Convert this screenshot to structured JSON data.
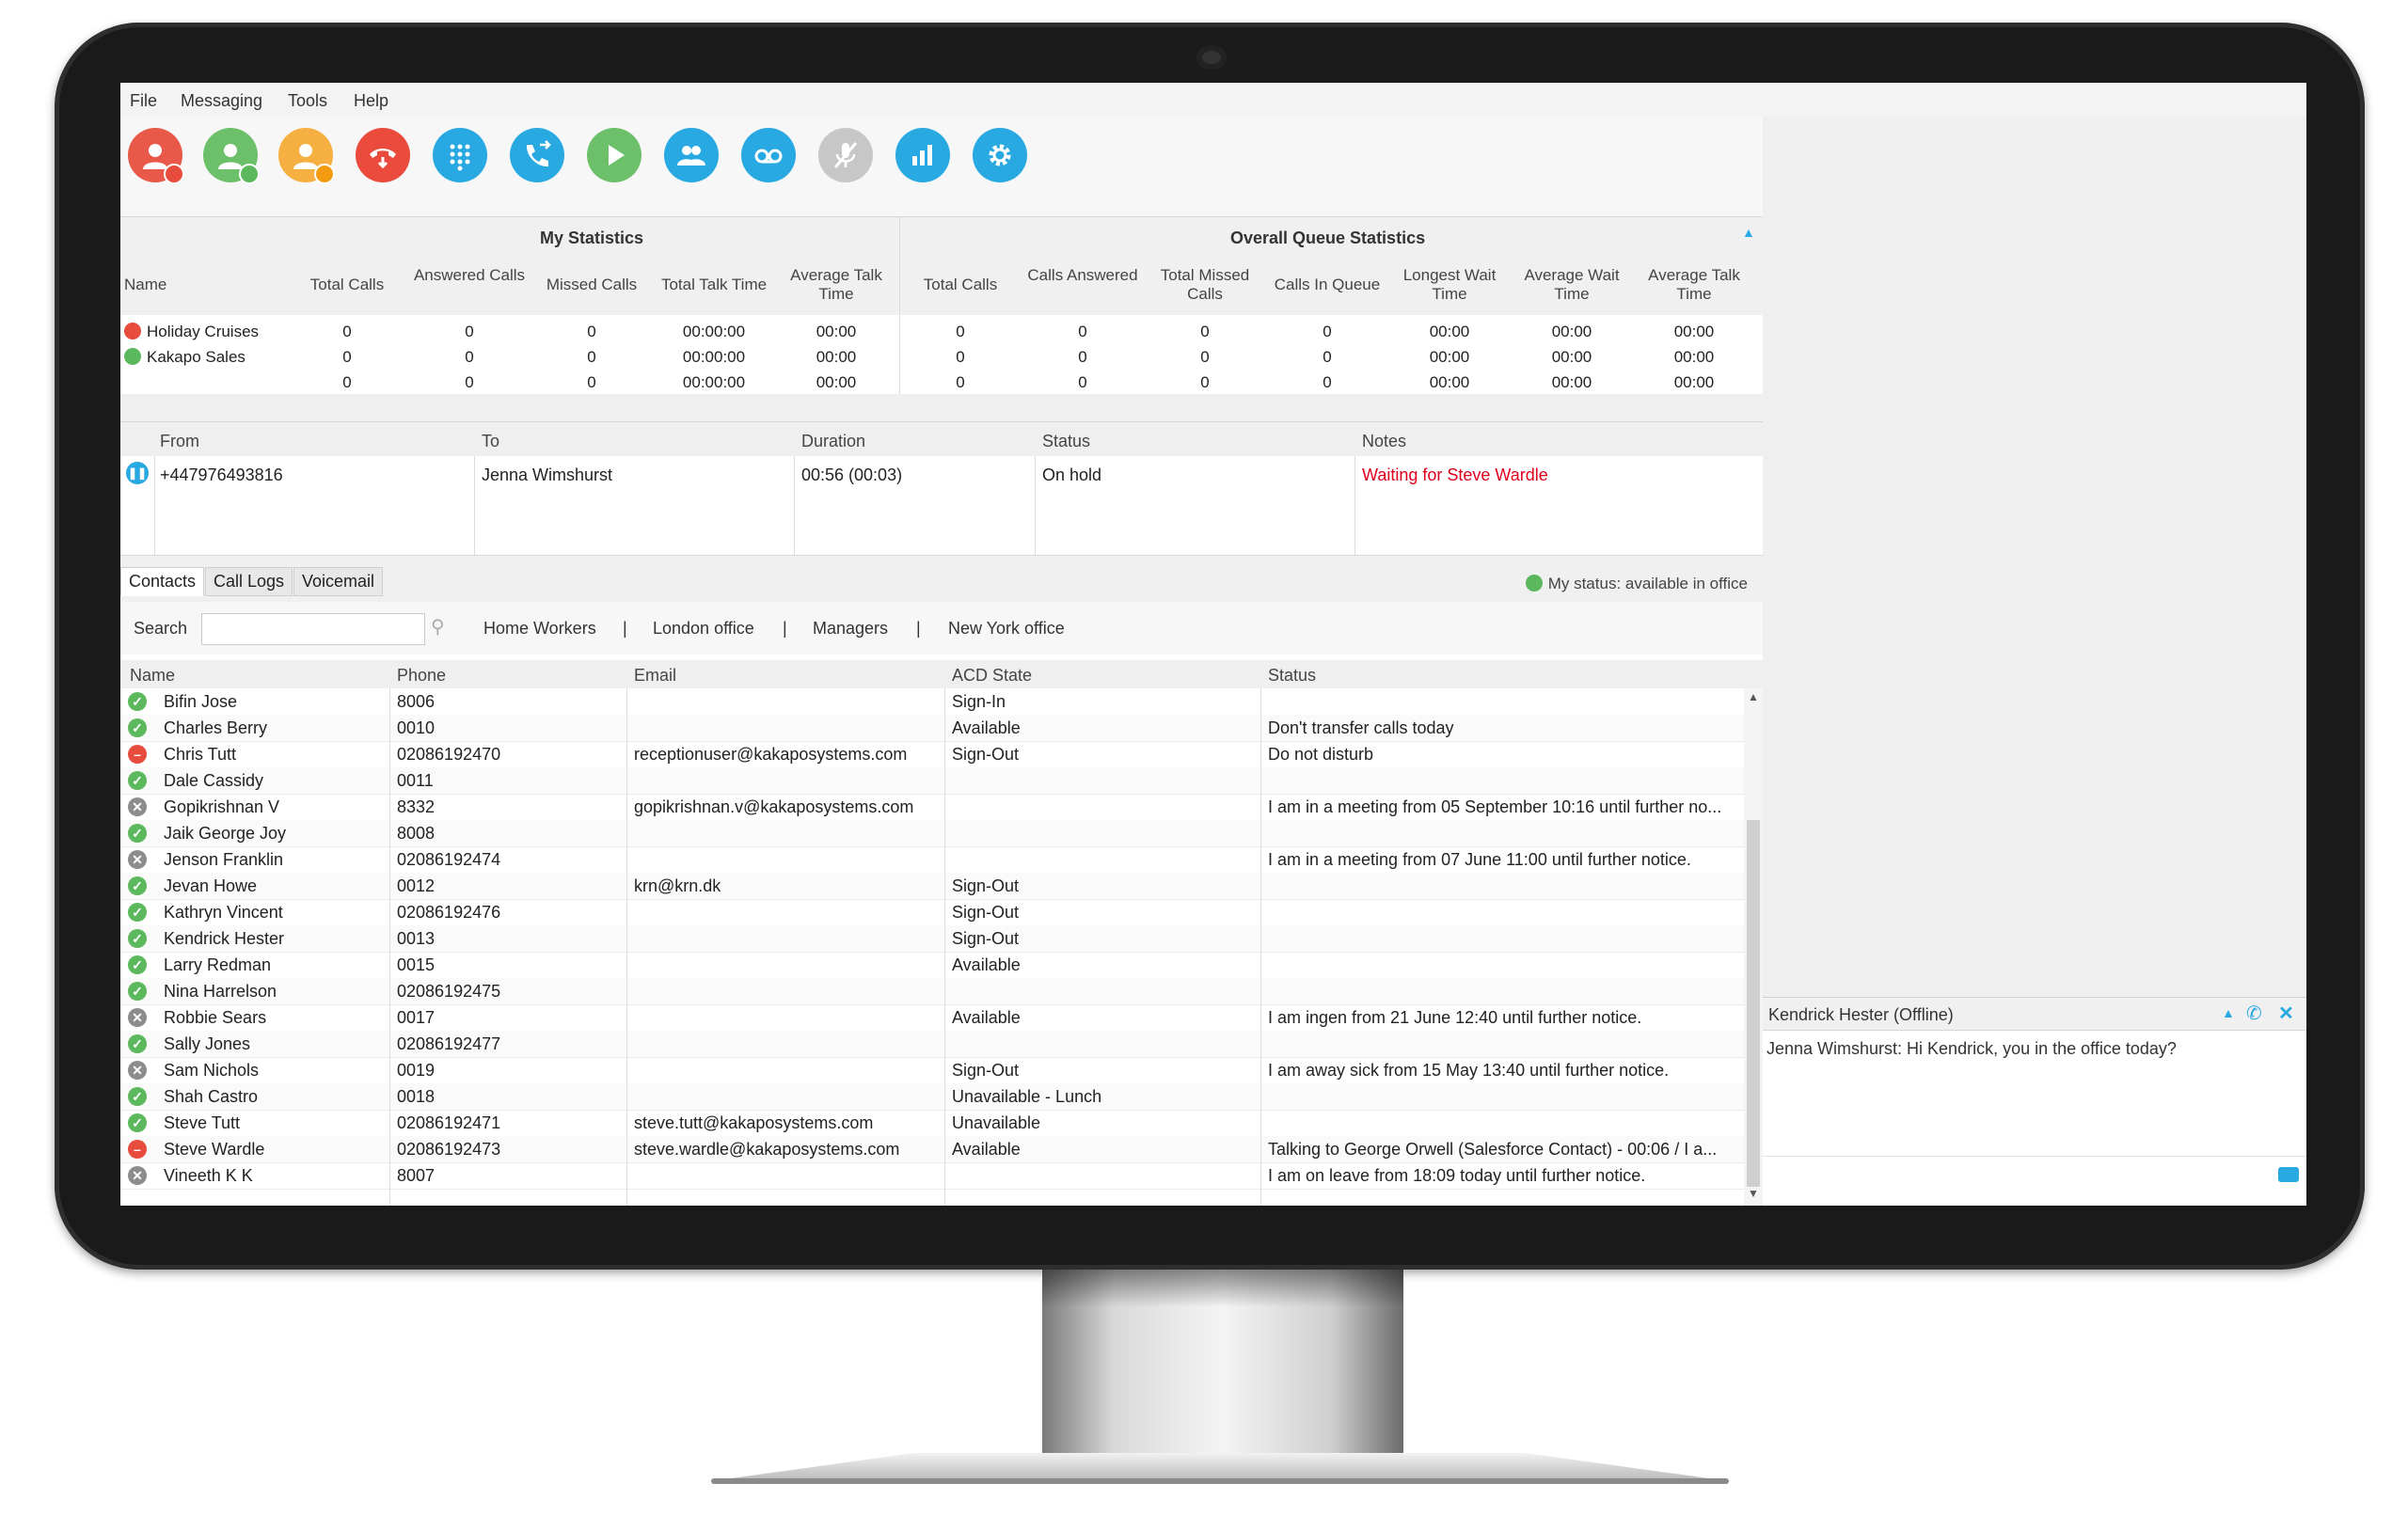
{
  "menu": [
    "File",
    "Messaging",
    "Tools",
    "Help"
  ],
  "toolbar_icons": [
    "user-busy-icon",
    "user-available-icon",
    "user-away-icon",
    "hangup-icon",
    "dialpad-icon",
    "transfer-call-icon",
    "play-icon",
    "group-icon",
    "voicemail-icon",
    "mute-icon",
    "statistics-icon",
    "settings-icon"
  ],
  "stats": {
    "my_title": "My Statistics",
    "queue_title": "Overall Queue Statistics",
    "headers": [
      "Name",
      "Total Calls",
      "Answered Calls",
      "Missed Calls",
      "Total Talk Time",
      "Average Talk Time",
      "Total Calls",
      "Calls Answered",
      "Total Missed Calls",
      "Calls In Queue",
      "Longest Wait Time",
      "Average Wait Time",
      "Average Talk Time"
    ],
    "rows": [
      {
        "name": "Holiday Cruises",
        "status": "#e74c3c",
        "values": [
          "0",
          "0",
          "0",
          "00:00:00",
          "00:00",
          "0",
          "0",
          "0",
          "0",
          "00:00",
          "00:00",
          "00:00"
        ]
      },
      {
        "name": "Kakapo Sales",
        "status": "#5cb85c",
        "values": [
          "0",
          "0",
          "0",
          "00:00:00",
          "00:00",
          "0",
          "0",
          "0",
          "0",
          "00:00",
          "00:00",
          "00:00"
        ]
      },
      {
        "name": "",
        "status": "",
        "values": [
          "0",
          "0",
          "0",
          "00:00:00",
          "00:00",
          "0",
          "0",
          "0",
          "0",
          "00:00",
          "00:00",
          "00:00"
        ]
      }
    ]
  },
  "queue": {
    "headers": [
      "From",
      "To",
      "Duration",
      "Status",
      "Notes"
    ],
    "rows": [
      {
        "from": "+447976493816",
        "to": "Jenna Wimshurst",
        "duration": "00:56 (00:03)",
        "status": "On hold",
        "notes": "Waiting for Steve Wardle"
      }
    ]
  },
  "tabs": [
    "Contacts",
    "Call Logs",
    "Voicemail"
  ],
  "my_status": "My status: available in office",
  "search_label": "Search",
  "groups": [
    "Home Workers",
    "|",
    "London office",
    "|",
    "Managers",
    "|",
    "New York office"
  ],
  "contacts_headers": [
    "Name",
    "Phone",
    "Email",
    "ACD State",
    "Status"
  ],
  "contacts": [
    {
      "s": "available",
      "name": "Bifin Jose",
      "phone": "8006",
      "email": "",
      "acd": "Sign-In",
      "status": ""
    },
    {
      "s": "available",
      "name": "Charles Berry",
      "phone": "0010",
      "email": "",
      "acd": "Available",
      "status": "Don't transfer calls today"
    },
    {
      "s": "busy",
      "name": "Chris Tutt",
      "phone": "02086192470",
      "email": "receptionuser@kakaposystems.com",
      "acd": "Sign-Out",
      "status": "Do not disturb"
    },
    {
      "s": "available",
      "name": "Dale Cassidy",
      "phone": "0011",
      "email": "",
      "acd": "",
      "status": ""
    },
    {
      "s": "offline",
      "name": "Gopikrishnan V",
      "phone": "8332",
      "email": "gopikrishnan.v@kakaposystems.com",
      "acd": "",
      "status": "I am in a meeting from 05 September 10:16 until further no..."
    },
    {
      "s": "available",
      "name": "Jaik George Joy",
      "phone": "8008",
      "email": "",
      "acd": "",
      "status": ""
    },
    {
      "s": "offline",
      "name": "Jenson Franklin",
      "phone": "02086192474",
      "email": "",
      "acd": "",
      "status": "I am in a meeting from 07 June 11:00 until further notice."
    },
    {
      "s": "available",
      "name": "Jevan Howe",
      "phone": "0012",
      "email": "krn@krn.dk",
      "acd": "Sign-Out",
      "status": ""
    },
    {
      "s": "available",
      "name": "Kathryn Vincent",
      "phone": "02086192476",
      "email": "",
      "acd": "Sign-Out",
      "status": ""
    },
    {
      "s": "available",
      "name": "Kendrick Hester",
      "phone": "0013",
      "email": "",
      "acd": "Sign-Out",
      "status": ""
    },
    {
      "s": "available",
      "name": "Larry Redman",
      "phone": "0015",
      "email": "",
      "acd": "Available",
      "status": ""
    },
    {
      "s": "available",
      "name": "Nina Harrelson",
      "phone": "02086192475",
      "email": "",
      "acd": "",
      "status": ""
    },
    {
      "s": "offline",
      "name": "Robbie Sears",
      "phone": "0017",
      "email": "",
      "acd": "Available",
      "status": "I am ingen from 21 June 12:40 until further notice."
    },
    {
      "s": "available",
      "name": "Sally Jones",
      "phone": "02086192477",
      "email": "",
      "acd": "",
      "status": ""
    },
    {
      "s": "offline",
      "name": "Sam Nichols",
      "phone": "0019",
      "email": "",
      "acd": "Sign-Out",
      "status": "I am away sick from 15 May 13:40 until further notice."
    },
    {
      "s": "available",
      "name": "Shah Castro",
      "phone": "0018",
      "email": "",
      "acd": "Unavailable - Lunch",
      "status": ""
    },
    {
      "s": "available",
      "name": "Steve Tutt",
      "phone": "02086192471",
      "email": "steve.tutt@kakaposystems.com",
      "acd": "Unavailable",
      "status": ""
    },
    {
      "s": "busy",
      "name": "Steve Wardle",
      "phone": "02086192473",
      "email": "steve.wardle@kakaposystems.com",
      "acd": "Available",
      "status": "Talking to George Orwell (Salesforce Contact) - 00:06 / I a..."
    },
    {
      "s": "offline",
      "name": "Vineeth K K",
      "phone": "8007",
      "email": "",
      "acd": "",
      "status": "I am on leave from 18:09 today until further notice."
    }
  ],
  "chat": {
    "title": "Kendrick Hester (Offline)",
    "message": "Jenna Wimshurst: Hi Kendrick, you in the office today?"
  },
  "colors": {
    "available": "#5cb85c",
    "busy": "#e74c3c",
    "offline": "#8c8c8c",
    "notes_red": "#e0001b",
    "accent": "#29a9e1"
  }
}
